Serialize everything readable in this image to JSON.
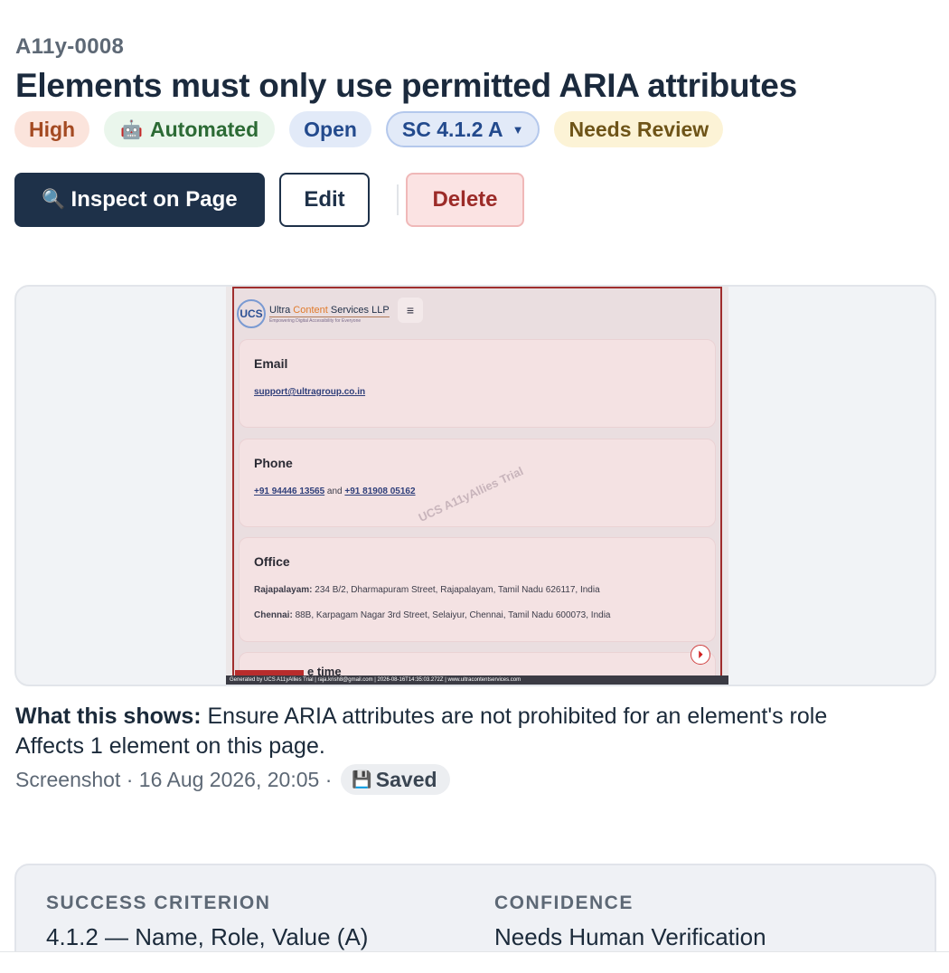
{
  "issue": {
    "id": "A11y-0008",
    "title": "Elements must only use permitted ARIA attributes"
  },
  "badges": {
    "severity": "High",
    "detection_icon": "robot-icon",
    "detection": "Automated",
    "status": "Open",
    "criterion": "SC 4.1.2 A",
    "review": "Needs Review"
  },
  "actions": {
    "inspect_icon": "magnifier-icon",
    "inspect": "Inspect on Page",
    "edit": "Edit",
    "delete": "Delete"
  },
  "screenshot": {
    "brand": "Ultra Content Services LLP",
    "brand_prefix": "Ultra ",
    "brand_accent": "Content",
    "brand_suffix": " Services LLP",
    "tagline": "Empowering Digital Accessibility for Everyone",
    "logo_mark": "UCS",
    "menu_glyph": "≡",
    "email_heading": "Email",
    "email_value": "support@ultragroup.co.in",
    "phone_heading": "Phone",
    "phone_1": "+91 94446 13565",
    "phone_and": "and",
    "phone_2": "+91 81908 05162",
    "office_heading": "Office",
    "office_1_label": "Rajapalayam:",
    "office_1_value": "234 B/2, Dharmapuram Street, Rajapalayam, Tamil Nadu 626117, India",
    "office_2_label": "Chennai:",
    "office_2_value": "88B, Karpagam Nagar 3rd Street, Selaiyur, Chennai, Tamil Nadu 600073, India",
    "partial_heading": "e time",
    "watermark": "UCS A11yAllies Trial",
    "footer": "Generated by UCS A11yAllies Trial | raja.krish8@gmail.com | 2026-08-16T14:35:03.272Z | www.ultracontentservices.com"
  },
  "explanation": {
    "label": "What this shows:",
    "text": " Ensure ARIA attributes are not prohibited for an element's role",
    "affects": "Affects 1 element on this page."
  },
  "meta": {
    "capture": "Screenshot · 16 Aug 2026, 20:05 ·",
    "saved_icon": "floppy-disk-icon",
    "saved": "Saved"
  },
  "details": {
    "criterion_label": "SUCCESS CRITERION",
    "criterion_value": "4.1.2 — Name, Role, Value (A)",
    "confidence_label": "CONFIDENCE",
    "confidence_value": "Needs Human Verification"
  },
  "colors": {
    "primary": "#1e3149",
    "danger": "#9c2b28",
    "severity_high": "#a44a22",
    "automated": "#2c6b35",
    "open": "#234a8d",
    "review": "#6e5418"
  }
}
